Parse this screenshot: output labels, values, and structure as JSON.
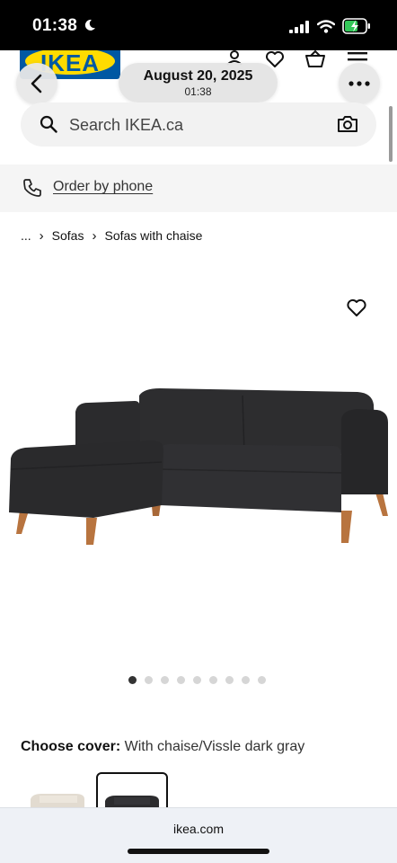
{
  "status_bar": {
    "time": "01:38",
    "icons": [
      "moon-icon",
      "signal-icon",
      "wifi-icon",
      "battery-charging-icon"
    ]
  },
  "header": {
    "logo_text": "IKEA",
    "icons": [
      "account-icon",
      "heart-icon",
      "basket-icon",
      "menu-icon"
    ],
    "colors": {
      "logo_blue": "#0058a3",
      "logo_yellow": "#ffdb00"
    }
  },
  "overlay": {
    "back_icon": "chevron-left-icon",
    "date": "August 20, 2025",
    "time": "01:38",
    "more_icon": "more-dots-icon"
  },
  "search": {
    "placeholder": "Search IKEA.ca",
    "icons": [
      "search-icon",
      "camera-icon"
    ]
  },
  "phone_order": {
    "label": "Order by phone",
    "icon": "phone-icon"
  },
  "breadcrumb": {
    "items": [
      "...",
      "Sofas",
      "Sofas with chaise"
    ]
  },
  "product": {
    "favorite_icon": "heart-outline-icon",
    "image_count": 9,
    "active_image": 1,
    "cover_label": "Choose cover:",
    "cover_value": "With chaise/Vissle dark gray",
    "swatches": [
      "beige",
      "dark gray"
    ],
    "selected_swatch": "dark gray"
  },
  "browser": {
    "url": "ikea.com"
  }
}
